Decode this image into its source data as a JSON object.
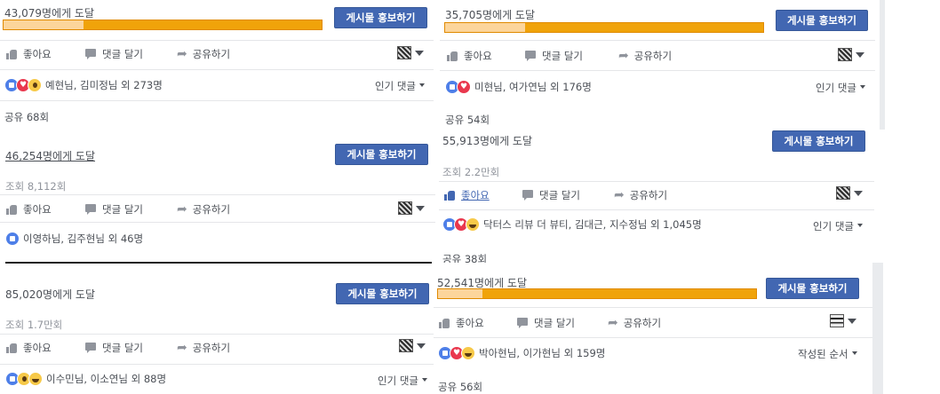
{
  "posts": [
    {
      "reach": "43,079명에게 도달",
      "promote": "게시물 홍보하기",
      "reach_fraction": 0.25,
      "actions": {
        "like": "좋아요",
        "comment": "댓글 달기",
        "share": "공유하기"
      },
      "reactions": [
        "like",
        "love",
        "wow"
      ],
      "reaction_names": "예현님, 김미정님 외 273명",
      "sort": "인기 댓글",
      "shares": "공유 68회"
    },
    {
      "reach": "35,705명에게 도달",
      "promote": "게시물 홍보하기",
      "reach_fraction": 0.25,
      "actions": {
        "like": "좋아요",
        "comment": "댓글 달기",
        "share": "공유하기"
      },
      "reactions": [
        "like",
        "love"
      ],
      "reaction_names": "미현님, 여가연님 외 176명",
      "sort": "인기 댓글",
      "shares": "공유 54회"
    },
    {
      "reach": "46,254명에게 도달",
      "promote": "게시물 홍보하기",
      "views": "조회 8,112회",
      "actions": {
        "like": "좋아요",
        "comment": "댓글 달기",
        "share": "공유하기"
      },
      "reactions": [
        "like"
      ],
      "reaction_names": "이영하님, 김주현님 외 46명"
    },
    {
      "reach": "55,913명에게 도달",
      "promote": "게시물 홍보하기",
      "views": "조회 2.2만회",
      "actions": {
        "like": "좋아요",
        "comment": "댓글 달기",
        "share": "공유하기"
      },
      "reactions": [
        "like",
        "love",
        "haha"
      ],
      "reaction_names": "닥터스 리뷰 더 뷰티, 김대근, 지수정님 외 1,045명",
      "sort": "인기 댓글",
      "shares": "공유 38회"
    },
    {
      "reach": "85,020명에게 도달",
      "promote": "게시물 홍보하기",
      "views": "조회 1.7만회",
      "actions": {
        "like": "좋아요",
        "comment": "댓글 달기",
        "share": "공유하기"
      },
      "reactions": [
        "like",
        "wow",
        "haha"
      ],
      "reaction_names": "이수민님, 이소연님 외 88명",
      "sort": "인기 댓글"
    },
    {
      "reach": "52,541명에게 도달",
      "promote": "게시물 홍보하기",
      "reach_fraction": 0.14,
      "actions": {
        "like": "좋아요",
        "comment": "댓글 달기",
        "share": "공유하기"
      },
      "reactions": [
        "like",
        "love",
        "haha"
      ],
      "reaction_names": "박아현님, 이가현님 외 159명",
      "sort": "작성된 순서",
      "shares": "공유 56회"
    }
  ],
  "colors": {
    "promote": "#4267b2",
    "bar_dark": "#f0a30a",
    "bar_light": "#fcd59b",
    "active_like": "#4267b2"
  }
}
